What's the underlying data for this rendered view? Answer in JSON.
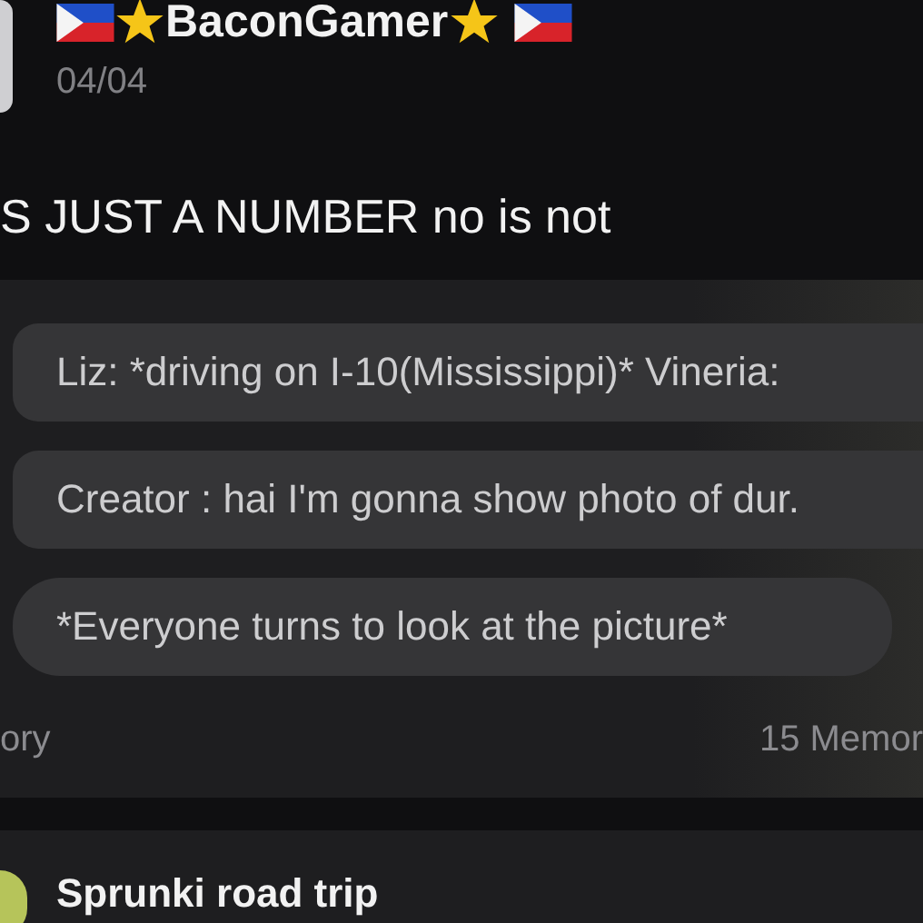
{
  "post": {
    "author": "BaconGamer",
    "date": "04/04",
    "text": "S JUST A NUMBER no is not"
  },
  "story_card": {
    "messages": [
      "Liz: *driving on I-10(Mississippi)* Vineria:",
      "Creator : hai I'm gonna show photo of dur.",
      "*Everyone turns to look at the picture*"
    ],
    "category": "ory",
    "memories": "15 Memor"
  },
  "next_card": {
    "title": "Sprunki road trip"
  }
}
